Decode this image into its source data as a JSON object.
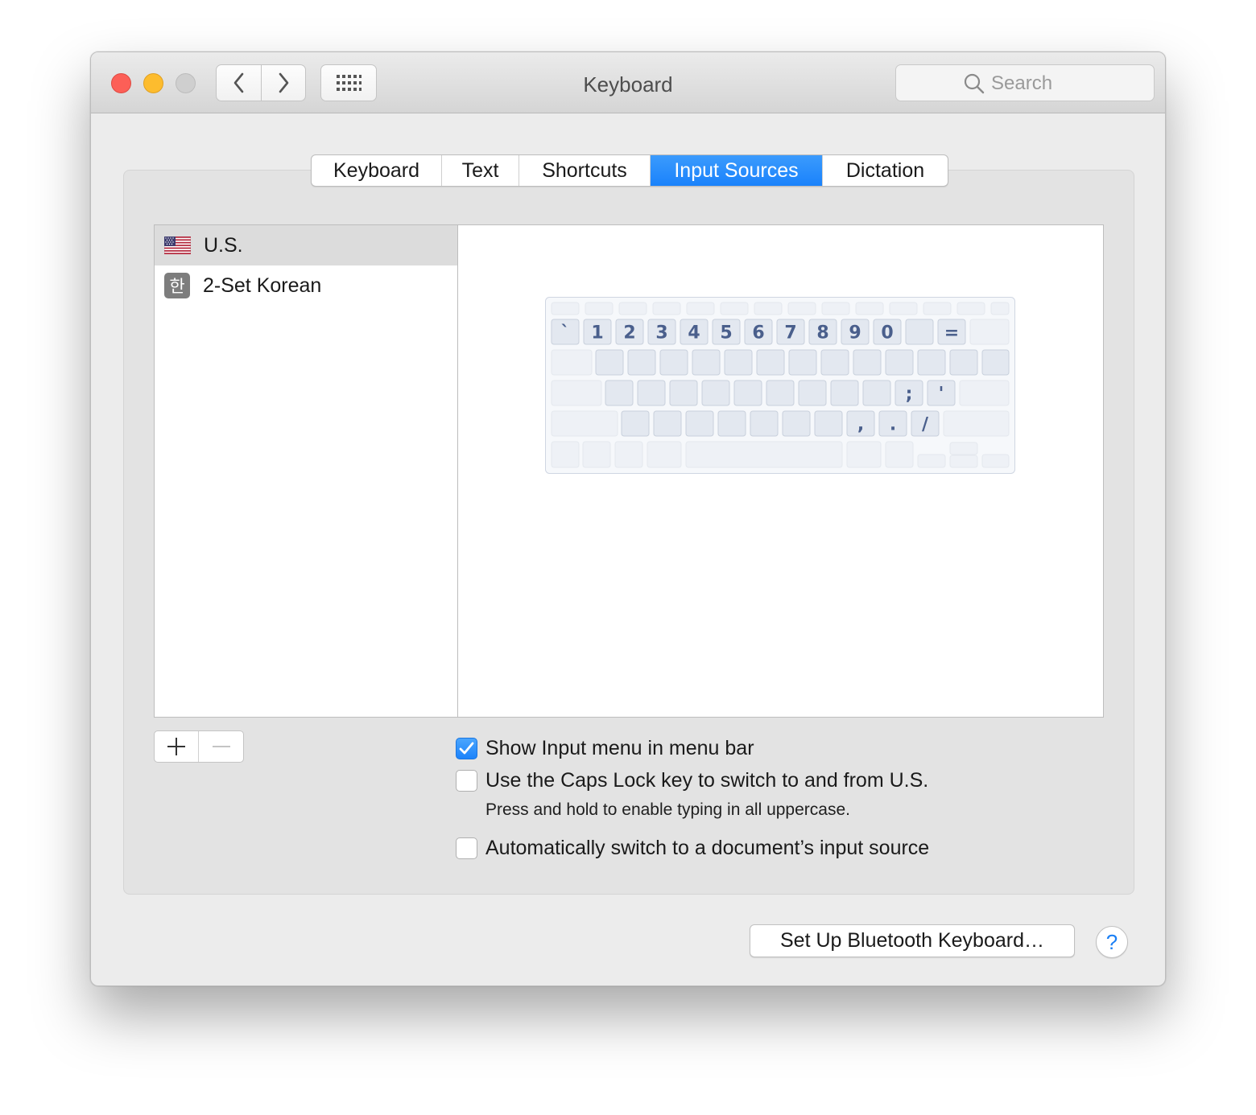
{
  "window": {
    "title": "Keyboard"
  },
  "toolbar": {
    "back_icon": "chevron-left-icon",
    "forward_icon": "chevron-right-icon",
    "grid_icon": "grid-icon"
  },
  "search": {
    "placeholder": "Search",
    "value": ""
  },
  "tabs": [
    {
      "label": "Keyboard",
      "active": false
    },
    {
      "label": "Text",
      "active": false
    },
    {
      "label": "Shortcuts",
      "active": false
    },
    {
      "label": "Input Sources",
      "active": true
    },
    {
      "label": "Dictation",
      "active": false
    }
  ],
  "sources": [
    {
      "label": "U.S.",
      "icon": "us-flag-icon",
      "selected": true
    },
    {
      "label": "2-Set Korean",
      "icon": "korean-icon",
      "icon_glyph": "한",
      "selected": false
    }
  ],
  "keyboard_preview": {
    "row1": [
      "`",
      "1",
      "2",
      "3",
      "4",
      "5",
      "6",
      "7",
      "8",
      "9",
      "0",
      "",
      "="
    ],
    "row3": [
      ";",
      "'"
    ],
    "row4": [
      ",",
      ".",
      "/"
    ]
  },
  "options": [
    {
      "label": "Show Input menu in menu bar",
      "checked": true
    },
    {
      "label": "Use the Caps Lock key to switch to and from U.S.",
      "checked": false,
      "hint": "Press and hold to enable typing in all uppercase."
    },
    {
      "label": "Automatically switch to a document’s input source",
      "checked": false
    }
  ],
  "footer": {
    "bluetooth_label": "Set Up Bluetooth Keyboard…",
    "help_label": "?"
  },
  "colors": {
    "accent": "#1a82fb",
    "key_label": "#4a5f8c",
    "key_fill": "#e3e8f0"
  }
}
